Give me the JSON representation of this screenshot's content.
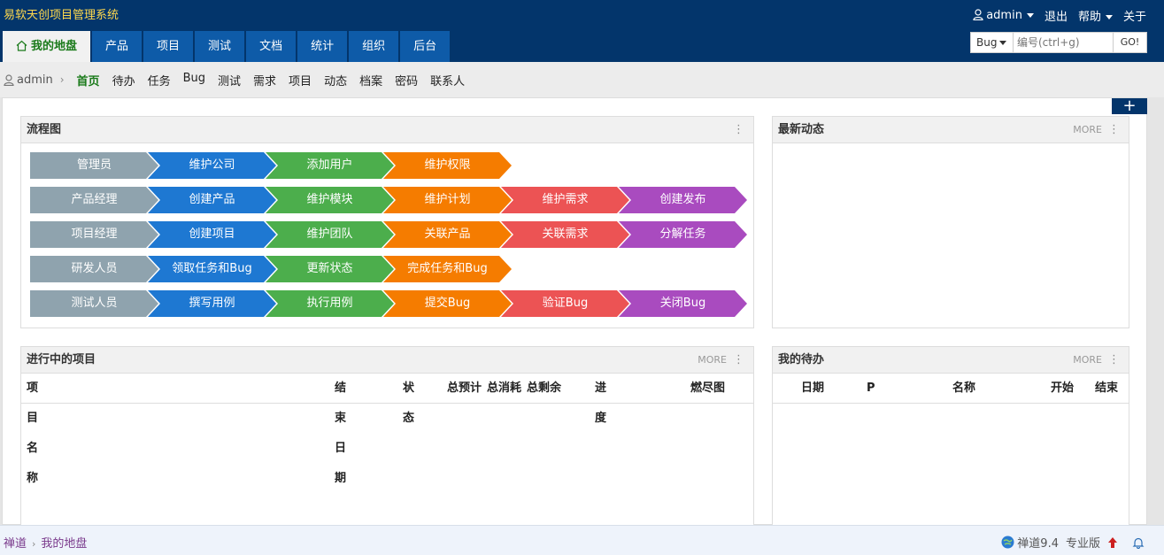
{
  "header": {
    "brand": "易软天创项目管理系统",
    "user": "admin",
    "logout": "退出",
    "help": "帮助",
    "about": "关于"
  },
  "main_nav": [
    {
      "label": "我的地盘",
      "active": true
    },
    {
      "label": "产品"
    },
    {
      "label": "项目"
    },
    {
      "label": "测试"
    },
    {
      "label": "文档"
    },
    {
      "label": "统计"
    },
    {
      "label": "组织"
    },
    {
      "label": "后台"
    }
  ],
  "search": {
    "type": "Bug",
    "placeholder": "编号(ctrl+g)",
    "go": "GO!"
  },
  "sub_nav": {
    "user": "admin",
    "items": [
      {
        "label": "首页",
        "active": true
      },
      {
        "label": "待办"
      },
      {
        "label": "任务"
      },
      {
        "label": "Bug"
      },
      {
        "label": "测试"
      },
      {
        "label": "需求"
      },
      {
        "label": "项目"
      },
      {
        "label": "动态"
      },
      {
        "label": "档案"
      },
      {
        "label": "密码"
      },
      {
        "label": "联系人"
      }
    ]
  },
  "add_button": "+",
  "flow_panel": {
    "title": "流程图",
    "rows": [
      [
        "管理员",
        "维护公司",
        "添加用户",
        "维护权限"
      ],
      [
        "产品经理",
        "创建产品",
        "维护模块",
        "维护计划",
        "维护需求",
        "创建发布"
      ],
      [
        "项目经理",
        "创建项目",
        "维护团队",
        "关联产品",
        "关联需求",
        "分解任务"
      ],
      [
        "研发人员",
        "领取任务和Bug",
        "更新状态",
        "完成任务和Bug"
      ],
      [
        "测试人员",
        "撰写用例",
        "执行用例",
        "提交Bug",
        "验证Bug",
        "关闭Bug"
      ]
    ],
    "colors": [
      "#8fa3ae",
      "#1e78d2",
      "#4cae4c",
      "#f57c00",
      "#ec5354",
      "#a94bbf"
    ]
  },
  "news_panel": {
    "title": "最新动态",
    "more": "MORE"
  },
  "project_panel": {
    "title": "进行中的项目",
    "more": "MORE",
    "columns": [
      "项目名称",
      "结束日期",
      "状态",
      "总预计",
      "总消耗",
      "总剩余",
      "进度",
      "燃尽图"
    ]
  },
  "todo_panel": {
    "title": "我的待办",
    "more": "MORE",
    "columns": [
      "日期",
      "P",
      "名称",
      "开始",
      "结束"
    ]
  },
  "footer": {
    "crumb_root": "禅道",
    "crumb_current": "我的地盘",
    "version": "禅道9.4",
    "edition": "专业版"
  }
}
